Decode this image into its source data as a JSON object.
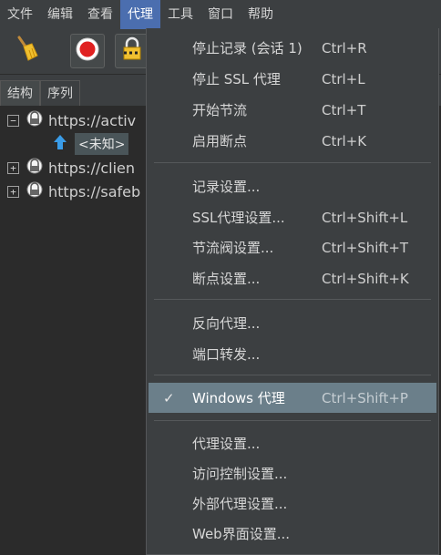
{
  "menubar": {
    "items": [
      "文件",
      "编辑",
      "查看",
      "代理",
      "工具",
      "窗口",
      "帮助"
    ],
    "active_index": 3
  },
  "toolbar": {
    "buttons": [
      "broom-icon",
      "record-icon",
      "lock-icon"
    ]
  },
  "tabs": {
    "structure": "结构",
    "sequence": "序列"
  },
  "tree": {
    "hosts": [
      "https://activ",
      "https://clien",
      "https://safeb"
    ],
    "child_label": "<未知>"
  },
  "proxy_menu": {
    "stop_recording": {
      "label": "停止记录 (会话 1)",
      "shortcut": "Ctrl+R"
    },
    "stop_ssl": {
      "label": "停止 SSL 代理",
      "shortcut": "Ctrl+L"
    },
    "start_throttle": {
      "label": "开始节流",
      "shortcut": "Ctrl+T"
    },
    "enable_breakpoints": {
      "label": "启用断点",
      "shortcut": "Ctrl+K"
    },
    "recording_settings": {
      "label": "记录设置..."
    },
    "ssl_settings": {
      "label": "SSL代理设置...",
      "shortcut": "Ctrl+Shift+L"
    },
    "throttle_settings": {
      "label": "节流阀设置...",
      "shortcut": "Ctrl+Shift+T"
    },
    "breakpoint_settings": {
      "label": "断点设置...",
      "shortcut": "Ctrl+Shift+K"
    },
    "reverse_proxy": {
      "label": "反向代理..."
    },
    "port_forwarding": {
      "label": "端口转发..."
    },
    "windows_proxy": {
      "label": "Windows 代理",
      "shortcut": "Ctrl+Shift+P",
      "checked": true
    },
    "proxy_settings": {
      "label": "代理设置..."
    },
    "access_control": {
      "label": "访问控制设置..."
    },
    "external_proxy": {
      "label": "外部代理设置..."
    },
    "web_interface": {
      "label": "Web界面设置..."
    }
  }
}
